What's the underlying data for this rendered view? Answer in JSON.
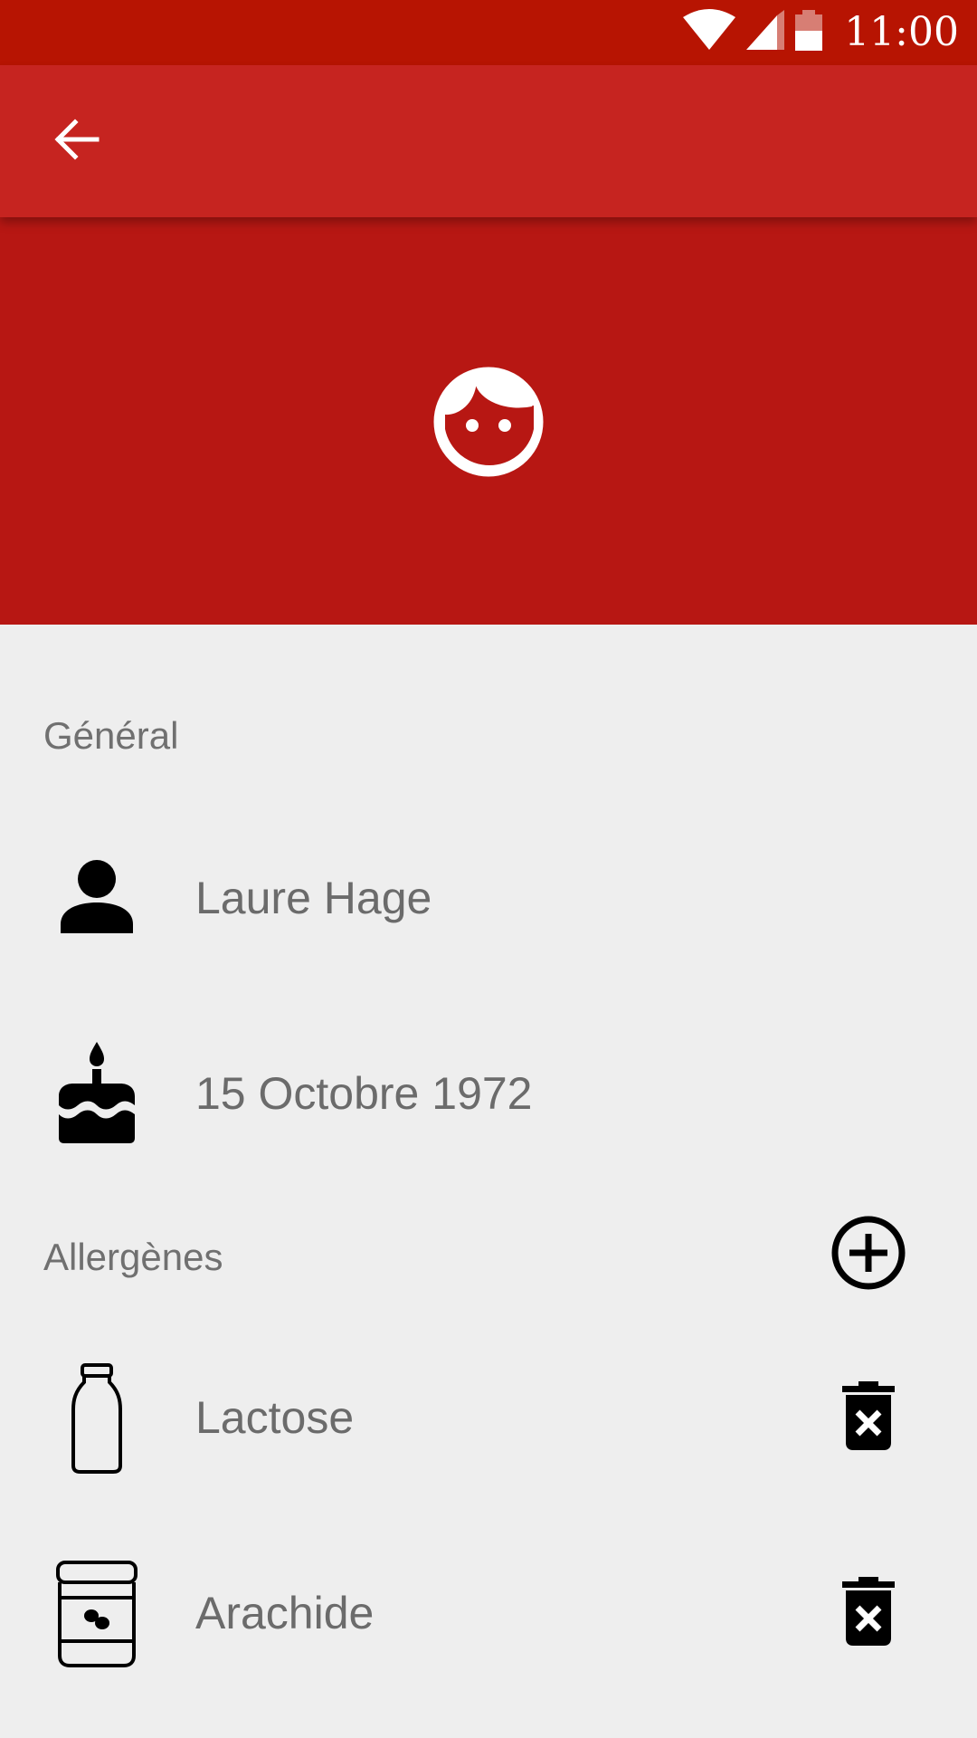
{
  "status_bar": {
    "time": "11:00",
    "icons": [
      "wifi-icon",
      "cell-signal-icon",
      "battery-icon"
    ],
    "color": "#b71402"
  },
  "app_bar": {
    "back_icon": "arrow-back-icon",
    "color": "#c62420"
  },
  "hero": {
    "avatar_icon": "face-icon",
    "color": "#b71713"
  },
  "general": {
    "header": "Général",
    "name": "Laure Hage",
    "name_icon": "person-icon",
    "birthdate": "15 Octobre 1972",
    "birthdate_icon": "cake-icon"
  },
  "allergens": {
    "header": "Allergènes",
    "add_icon": "add-circle-icon",
    "items": [
      {
        "label": "Lactose",
        "icon": "milk-bottle-icon",
        "delete_icon": "delete-forever-icon"
      },
      {
        "label": "Arachide",
        "icon": "peanut-jar-icon",
        "delete_icon": "delete-forever-icon"
      }
    ]
  }
}
